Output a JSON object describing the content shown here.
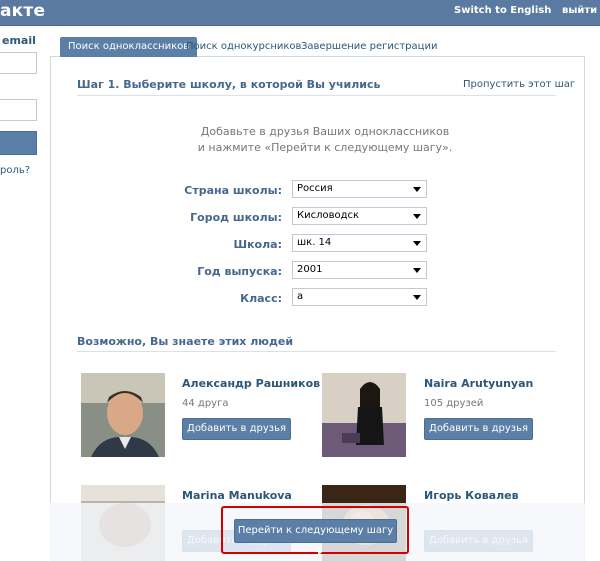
{
  "header": {
    "logo": "акте",
    "switch_lang": "Switch to English",
    "logout": "выйти"
  },
  "sidebar": {
    "email_label": "email",
    "forgot": "роль?"
  },
  "tabs": [
    {
      "label": "Поиск одноклассников",
      "active": true
    },
    {
      "label": "Поиск однокурсников",
      "active": false
    },
    {
      "label": "Завершение регистрации",
      "active": false
    }
  ],
  "step": {
    "title": "Шаг 1. Выберите школу, в которой Вы учились",
    "skip": "Пропустить этот шаг"
  },
  "description": {
    "line1": "Добавьте в друзья Ваших одноклассников",
    "line2": "и нажмите «Перейти к следующему шагу»."
  },
  "form": {
    "country": {
      "label": "Страна школы:",
      "value": "Россия"
    },
    "city": {
      "label": "Город школы:",
      "value": "Кисловодск"
    },
    "school": {
      "label": "Школа:",
      "value": "шк. 14"
    },
    "year": {
      "label": "Год выпуска:",
      "value": "2001"
    },
    "class": {
      "label": "Класс:",
      "value": "а"
    }
  },
  "people": {
    "title": "Возможно, Вы знаете этих людей",
    "add_label": "Добавить в друзья",
    "list": [
      {
        "name": "Александр Рашников",
        "friends": "44 друга"
      },
      {
        "name": "Naira Arutyunyan",
        "friends": "105 друзей"
      },
      {
        "name": "Marina Manukova",
        "friends": ""
      },
      {
        "name": "Игорь Ковалев",
        "friends": ""
      }
    ]
  },
  "next_button": "Перейти к следующему шагу",
  "colors": {
    "header": "#5a7aa2",
    "button": "#5b7fa6",
    "link": "#2b587a",
    "highlight": "#d40000"
  }
}
